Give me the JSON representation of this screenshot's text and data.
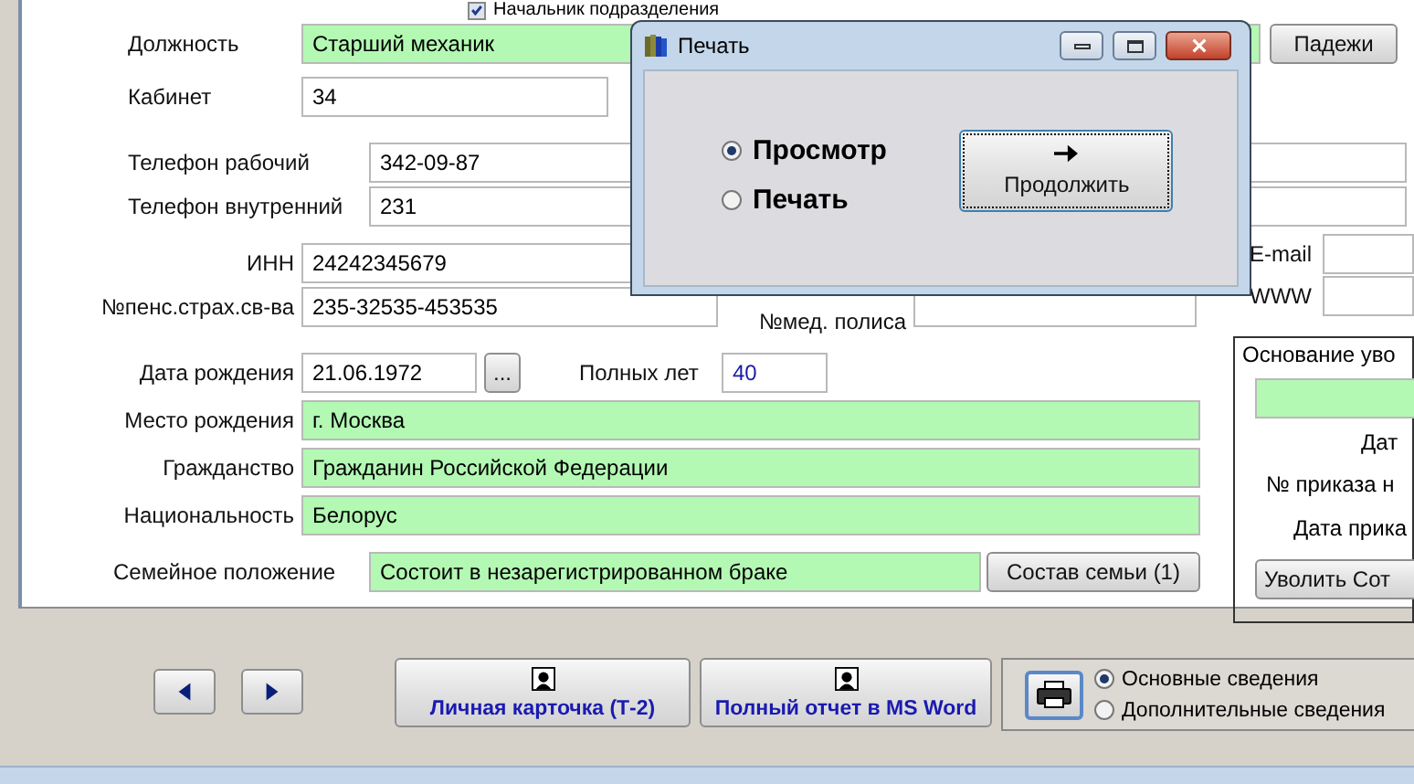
{
  "head_checkbox": {
    "label": "Начальник подразделения",
    "checked": true
  },
  "fields": [
    {
      "label": "Должность",
      "value": "Старший механик",
      "highlighted": true
    },
    {
      "label": "Кабинет",
      "value": "34",
      "highlighted": false
    },
    {
      "label": "Телефон рабочий",
      "value": "342-09-87",
      "highlighted": false
    },
    {
      "label": "Телефон внутренний",
      "value": "231",
      "highlighted": false
    },
    {
      "label": "ИНН",
      "value": "24242345679",
      "highlighted": false
    },
    {
      "label": "№пенс.страх.св-ва",
      "value": "235-32535-453535",
      "highlighted": false
    },
    {
      "label": "№мед. полиса",
      "highlighted": false
    },
    {
      "label": "Дата рождения",
      "value": "21.06.1972",
      "highlighted": false
    },
    {
      "label": "Полных лет",
      "value": "40",
      "highlighted": false
    },
    {
      "label": "Место рождения",
      "value": "г. Москва",
      "highlighted": true
    },
    {
      "label": "Гражданство",
      "value": "Гражданин Российской Федерации",
      "highlighted": true
    },
    {
      "label": "Национальность",
      "value": "Белорус",
      "highlighted": true
    },
    {
      "label": "Семейное положение",
      "value": "Состоит в незарегистрированном браке",
      "highlighted": true
    }
  ],
  "cases_button": "Падежи",
  "date_button": "...",
  "family_button": "Состав семьи (1)",
  "contacts": [
    {
      "label": "E-mail"
    },
    {
      "label": "WWW"
    }
  ],
  "dismissal": {
    "title": "Основание уво",
    "labels": [
      "Дат",
      "№ приказа н",
      "Дата прика"
    ],
    "button": "Уволить Сот"
  },
  "report_buttons": [
    "Личная карточка (Т-2)",
    "Полный отчет в MS Word"
  ],
  "report_options": [
    {
      "label": "Основные сведения",
      "selected": true
    },
    {
      "label": "Дополнительные сведения",
      "selected": false
    }
  ],
  "dialog": {
    "title": "Печать",
    "options": [
      {
        "label": "Просмотр",
        "selected": true
      },
      {
        "label": "Печать",
        "selected": false
      }
    ],
    "button": "Продолжить"
  }
}
